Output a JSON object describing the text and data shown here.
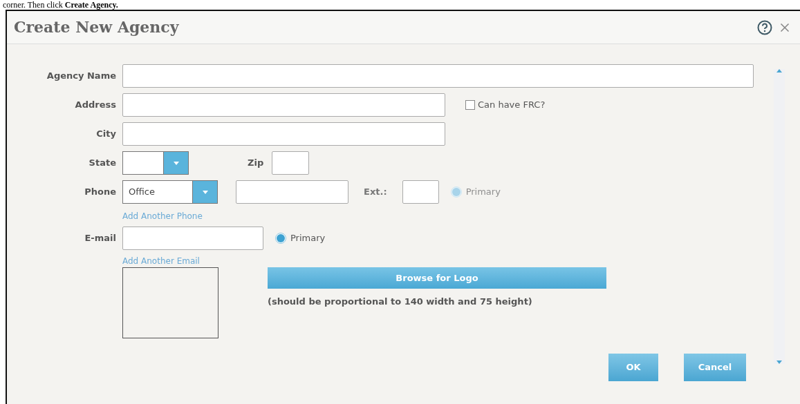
{
  "instruction_text": "corner. Then click **Create Agency.**",
  "dialog": {
    "title": "Create New Agency"
  },
  "agency_name": {
    "label": "Agency Name"
  },
  "address": {
    "label": "Address"
  },
  "can_have_frc": {
    "label": "Can have FRC?",
    "checked": false
  },
  "city": {
    "label": "City"
  },
  "state": {
    "label": "State"
  },
  "zip": {
    "label": "Zip"
  },
  "phone": {
    "label": "Phone",
    "type_value": "Office",
    "ext_label": "Ext.:",
    "primary": {
      "label": "Primary",
      "selected": true,
      "disabled": true
    },
    "add_link": "Add Another Phone"
  },
  "email": {
    "label": "E-mail",
    "primary": {
      "label": "Primary",
      "selected": true,
      "disabled": false
    },
    "add_link": "Add Another Email"
  },
  "logo": {
    "browse_button": "Browse for Logo",
    "note": "(should be proportional to 140 width and 75 height)"
  },
  "buttons": [
    {
      "label": "OK"
    },
    {
      "label": "Cancel"
    }
  ]
}
